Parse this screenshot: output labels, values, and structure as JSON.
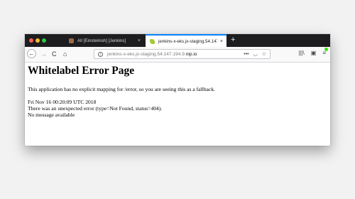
{
  "tabs": [
    {
      "label": "All [Einsteinish] [Jenkins]",
      "close": "×",
      "active": false
    },
    {
      "label": "jenkins-x-eks.jx-staging.54.147",
      "close": "×",
      "active": true
    }
  ],
  "new_tab_label": "+",
  "toolbar": {
    "back": "←",
    "forward": "→",
    "reload": "C",
    "home": "⌂"
  },
  "address_bar": {
    "info": "i",
    "url_prefix": "jenkins-x-eks.jx-staging.54.147.194.9.",
    "url_host": "nip.io",
    "more": "•••",
    "pocket": "◡",
    "bookmark": "☆"
  },
  "right_toolbar": {
    "library": "|||\\",
    "sidebar": "▣",
    "menu": "≡"
  },
  "page": {
    "heading": "Whitelabel Error Page",
    "message": "This application has no explicit mapping for /error, so you are seeing this as a fallback.",
    "timestamp": "Fri Nov 16 00:20:09 UTC 2018",
    "error": "There was an unexpected error (type=Not Found, status=404).",
    "detail": "No message available"
  }
}
